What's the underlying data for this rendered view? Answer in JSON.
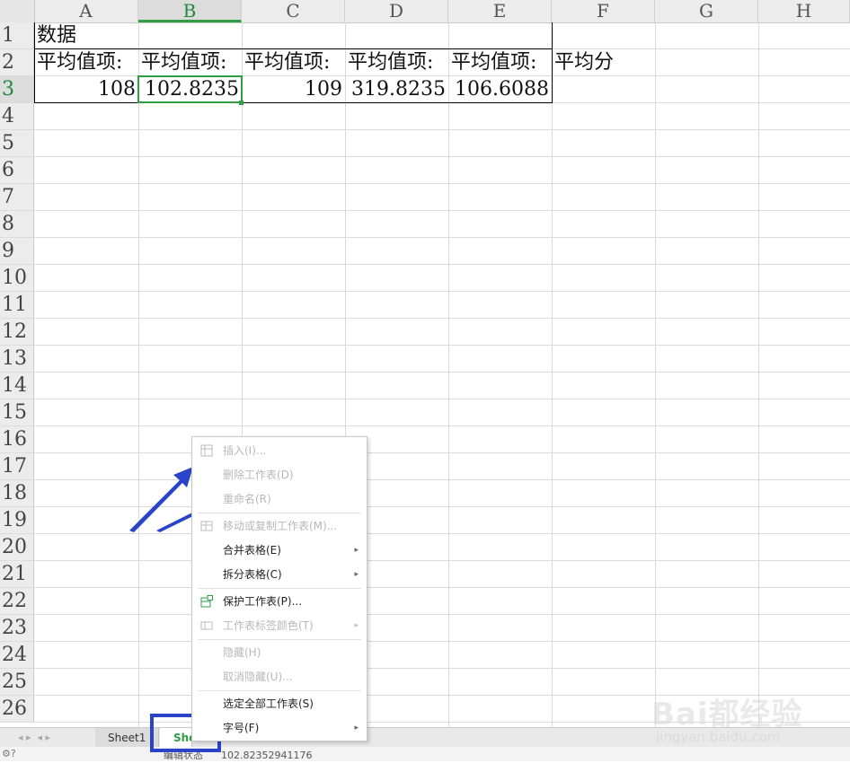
{
  "columns": [
    "A",
    "B",
    "C",
    "D",
    "E",
    "F",
    "G",
    "H"
  ],
  "rows": [
    "1",
    "2",
    "3",
    "4",
    "5",
    "6",
    "7",
    "8",
    "9",
    "10",
    "11",
    "12",
    "13",
    "14",
    "15",
    "16",
    "17",
    "18",
    "19",
    "20",
    "21",
    "22",
    "23",
    "24",
    "25",
    "26"
  ],
  "cells": {
    "A1": "数据",
    "A2": "平均值项:",
    "B2": "平均值项:",
    "C2": "平均值项:",
    "D2": "平均值项:",
    "E2": "平均值项:",
    "F2": "平均分",
    "A3": "108",
    "B3": "102.8235",
    "C3": "109",
    "D3": "319.8235",
    "E3": "106.6088"
  },
  "context_menu": {
    "items": [
      {
        "label": "插入(I)...",
        "enabled": false,
        "icon": "insert-table-icon"
      },
      {
        "label": "删除工作表(D)",
        "enabled": false
      },
      {
        "label": "重命名(R)",
        "enabled": false
      },
      {
        "label": "移动或复制工作表(M)...",
        "enabled": false,
        "icon": "move-copy-icon"
      },
      {
        "label": "合并表格(E)",
        "enabled": true,
        "submenu": true
      },
      {
        "label": "拆分表格(C)",
        "enabled": true,
        "submenu": true
      },
      {
        "label": "保护工作表(P)...",
        "enabled": true,
        "icon": "protect-sheet-icon"
      },
      {
        "label": "工作表标签颜色(T)",
        "enabled": false,
        "submenu": true,
        "icon": "tab-color-icon"
      },
      {
        "label": "隐藏(H)",
        "enabled": false
      },
      {
        "label": "取消隐藏(U)...",
        "enabled": false
      },
      {
        "label": "选定全部工作表(S)",
        "enabled": true
      },
      {
        "label": "字号(F)",
        "enabled": true,
        "submenu": true
      }
    ],
    "arrow_glyph": "▸"
  },
  "tabs": {
    "sheet1": "Sheet1",
    "sheet2_partial": "She"
  },
  "status": {
    "mode": "编辑状态",
    "value": "102.82352941176"
  },
  "watermark": {
    "brand": "Bai都经验",
    "url": "jingyan.baidu.com"
  },
  "colors": {
    "accent_green": "#2f9e44",
    "annotation_blue": "#2944c8"
  }
}
